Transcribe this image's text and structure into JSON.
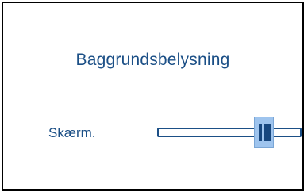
{
  "dialog": {
    "title": "Baggrundsbelysning"
  },
  "settings": {
    "screen_label": "Skærm.",
    "screen_level": 0.78
  },
  "colors": {
    "text": "#1b4f86",
    "thumb": "#9ec4ee",
    "grip": "#17477f",
    "border": "#000000"
  }
}
